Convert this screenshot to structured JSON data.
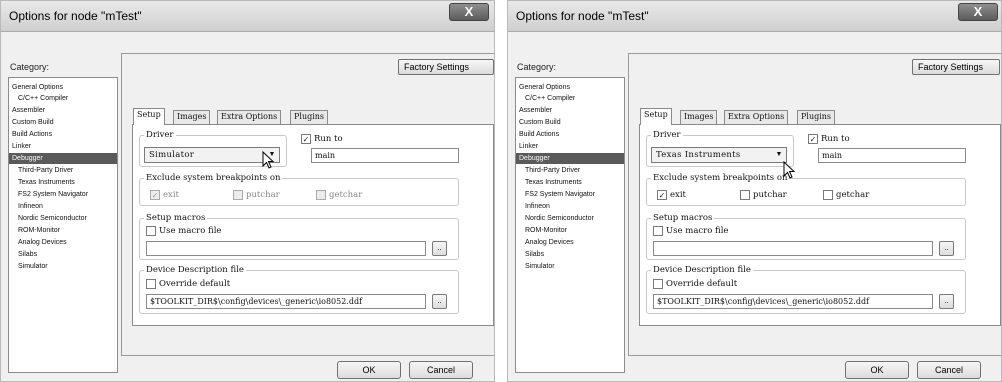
{
  "dialogs": [
    {
      "title": "Options for node \"mTest\"",
      "close_glyph": "X",
      "category_label": "Category:",
      "categories": [
        {
          "label": "General Options",
          "selected": false
        },
        {
          "label": "C/C++ Compiler",
          "selected": false
        },
        {
          "label": "Assembler",
          "selected": false
        },
        {
          "label": "Custom Build",
          "selected": false
        },
        {
          "label": "Build Actions",
          "selected": false
        },
        {
          "label": "Linker",
          "selected": false
        },
        {
          "label": "Debugger",
          "selected": true
        },
        {
          "label": "Third-Party Driver",
          "selected": false
        },
        {
          "label": "Texas Instruments",
          "selected": false
        },
        {
          "label": "FS2 System Navigator",
          "selected": false
        },
        {
          "label": "Infineon",
          "selected": false
        },
        {
          "label": "Nordic Semiconductor",
          "selected": false
        },
        {
          "label": "ROM-Monitor",
          "selected": false
        },
        {
          "label": "Analog Devices",
          "selected": false
        },
        {
          "label": "Silabs",
          "selected": false
        },
        {
          "label": "Simulator",
          "selected": false
        }
      ],
      "factory_settings_label": "Factory Settings",
      "tabs": [
        {
          "label": "Setup",
          "active": true
        },
        {
          "label": "Images",
          "active": false
        },
        {
          "label": "Extra Options",
          "active": false
        },
        {
          "label": "Plugins",
          "active": false
        }
      ],
      "driver": {
        "label": "Driver",
        "value": "Simulator",
        "arrow": "▼"
      },
      "run_to": {
        "label": "Run to",
        "checked": true,
        "value": "main"
      },
      "breakpoints": {
        "label": "Exclude system breakpoints on",
        "items": [
          {
            "label": "exit",
            "checked": true,
            "enabled": false
          },
          {
            "label": "putchar",
            "checked": false,
            "enabled": false
          },
          {
            "label": "getchar",
            "checked": false,
            "enabled": false
          }
        ]
      },
      "macros": {
        "label": "Setup macros",
        "use_label": "Use macro file",
        "checked": false,
        "value": "",
        "browse": ".."
      },
      "ddf": {
        "label": "Device Description file",
        "override_label": "Override default",
        "checked": false,
        "value": "$TOOLKIT_DIR$\\config\\devices\\_generic\\io8052.ddf",
        "browse": ".."
      },
      "ok_label": "OK",
      "cancel_label": "Cancel"
    },
    {
      "title": "Options for node \"mTest\"",
      "close_glyph": "X",
      "category_label": "Category:",
      "categories": [
        {
          "label": "General Options",
          "selected": false
        },
        {
          "label": "C/C++ Compiler",
          "selected": false
        },
        {
          "label": "Assembler",
          "selected": false
        },
        {
          "label": "Custom Build",
          "selected": false
        },
        {
          "label": "Build Actions",
          "selected": false
        },
        {
          "label": "Linker",
          "selected": false
        },
        {
          "label": "Debugger",
          "selected": true
        },
        {
          "label": "Third-Party Driver",
          "selected": false
        },
        {
          "label": "Texas Instruments",
          "selected": false
        },
        {
          "label": "FS2 System Navigator",
          "selected": false
        },
        {
          "label": "Infineon",
          "selected": false
        },
        {
          "label": "Nordic Semiconductor",
          "selected": false
        },
        {
          "label": "ROM-Monitor",
          "selected": false
        },
        {
          "label": "Analog Devices",
          "selected": false
        },
        {
          "label": "Silabs",
          "selected": false
        },
        {
          "label": "Simulator",
          "selected": false
        }
      ],
      "factory_settings_label": "Factory Settings",
      "tabs": [
        {
          "label": "Setup",
          "active": true
        },
        {
          "label": "Images",
          "active": false
        },
        {
          "label": "Extra Options",
          "active": false
        },
        {
          "label": "Plugins",
          "active": false
        }
      ],
      "driver": {
        "label": "Driver",
        "value": "Texas Instruments",
        "arrow": "▼"
      },
      "run_to": {
        "label": "Run to",
        "checked": true,
        "value": "main"
      },
      "breakpoints": {
        "label": "Exclude system breakpoints on",
        "items": [
          {
            "label": "exit",
            "checked": true,
            "enabled": true
          },
          {
            "label": "putchar",
            "checked": false,
            "enabled": true
          },
          {
            "label": "getchar",
            "checked": false,
            "enabled": true
          }
        ]
      },
      "macros": {
        "label": "Setup macros",
        "use_label": "Use macro file",
        "checked": false,
        "value": "",
        "browse": ".."
      },
      "ddf": {
        "label": "Device Description file",
        "override_label": "Override default",
        "checked": false,
        "value": "$TOOLKIT_DIR$\\config\\devices\\_generic\\io8052.ddf",
        "browse": ".."
      },
      "ok_label": "OK",
      "cancel_label": "Cancel"
    }
  ]
}
